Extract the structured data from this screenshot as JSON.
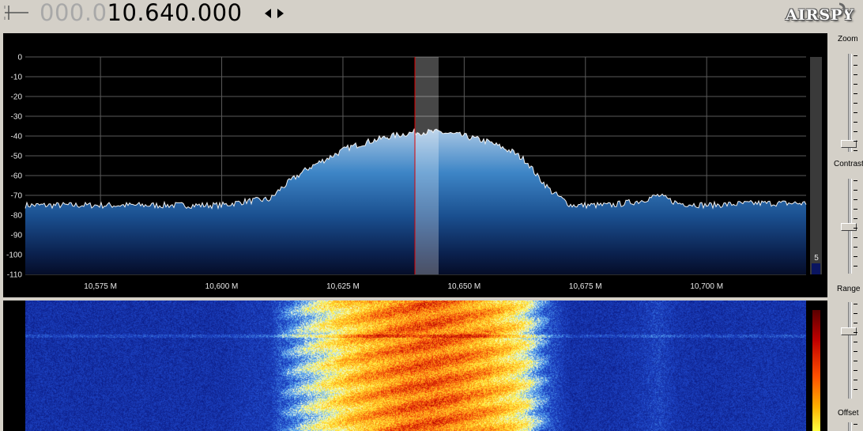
{
  "toolbar": {
    "frequency_dim": "000.0",
    "frequency_lit": "10.640.000",
    "logo": "AIRSPY"
  },
  "spectrum": {
    "y_ticks": [
      "0",
      "-10",
      "-20",
      "-30",
      "-40",
      "-50",
      "-60",
      "-70",
      "-80",
      "-90",
      "-100",
      "-110"
    ],
    "x_ticks": [
      "10,575 M",
      "10,600 M",
      "10,625 M",
      "10,650 M",
      "10,675 M",
      "10,700 M"
    ],
    "averaging_value": "5",
    "center_frequency_mhz": 10.64,
    "filter_bandwidth_khz": 5
  },
  "side_panel": {
    "zoom_label": "Zoom",
    "contrast_label": "Contrast",
    "range_label": "Range",
    "offset_label": "Offset"
  },
  "chart_data": {
    "type": "area",
    "title": "",
    "xlabel": "",
    "ylabel": "",
    "xlim": [
      10.5595,
      10.7205
    ],
    "ylim": [
      -110,
      0
    ],
    "x_unit": "M",
    "grid": true,
    "x": [
      10.56,
      10.58,
      10.6,
      10.605,
      10.61,
      10.612,
      10.614,
      10.618,
      10.622,
      10.626,
      10.63,
      10.635,
      10.64,
      10.645,
      10.65,
      10.655,
      10.66,
      10.663,
      10.665,
      10.668,
      10.672,
      10.68,
      10.686,
      10.69,
      10.694,
      10.7,
      10.71,
      10.72
    ],
    "values": [
      -75,
      -75,
      -75,
      -73,
      -72,
      -67,
      -63,
      -56,
      -51,
      -46,
      -43,
      -40,
      -38,
      -38,
      -40,
      -43,
      -48,
      -53,
      -60,
      -68,
      -75,
      -75,
      -73,
      -70,
      -74,
      -75,
      -74,
      -74
    ]
  }
}
